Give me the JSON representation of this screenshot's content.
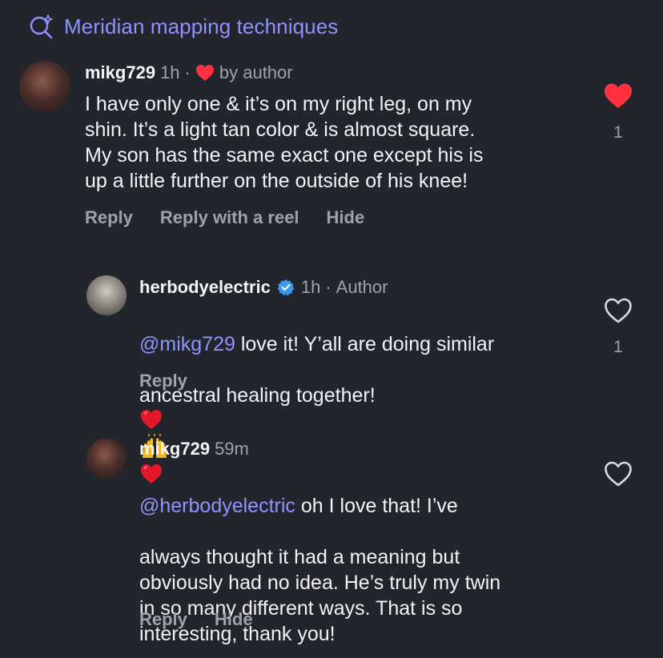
{
  "search": {
    "query": "Meridian mapping techniques"
  },
  "comments": [
    {
      "username": "mikg729",
      "time": "1h",
      "sep": "·",
      "author_like": "by author",
      "text": "I have only one & it’s on my right leg, on my\nshin. It’s a light tan color & is almost square.\nMy son has the same exact one except his is\nup a little further on the outside of his knee!",
      "like_count": "1",
      "liked": true,
      "actions": {
        "reply": "Reply",
        "reply_reel": "Reply with a reel",
        "hide": "Hide"
      }
    },
    {
      "username": "herbodyelectric",
      "time": "1h",
      "sep": "·",
      "role": "Author",
      "mention": "@mikg729",
      "text_1": " love it! Y’all are doing similar",
      "text_2": "ancestral healing together! ",
      "like_count": "1",
      "liked": false,
      "actions": {
        "reply": "Reply"
      }
    },
    {
      "username": "mikg729",
      "time": "59m",
      "mention": "@herbodyelectric",
      "text_1": " oh I love that! I’ve",
      "text_rest": "always thought it had a meaning but\nobviously had no idea. He’s truly my twin\nin so many different ways. That is so\ninteresting, thank you!",
      "liked": false,
      "actions": {
        "reply": "Reply",
        "hide": "Hide"
      }
    }
  ],
  "colors": {
    "accent": "#8f93ff",
    "like": "#ff3040",
    "verified": "#3897f0"
  }
}
